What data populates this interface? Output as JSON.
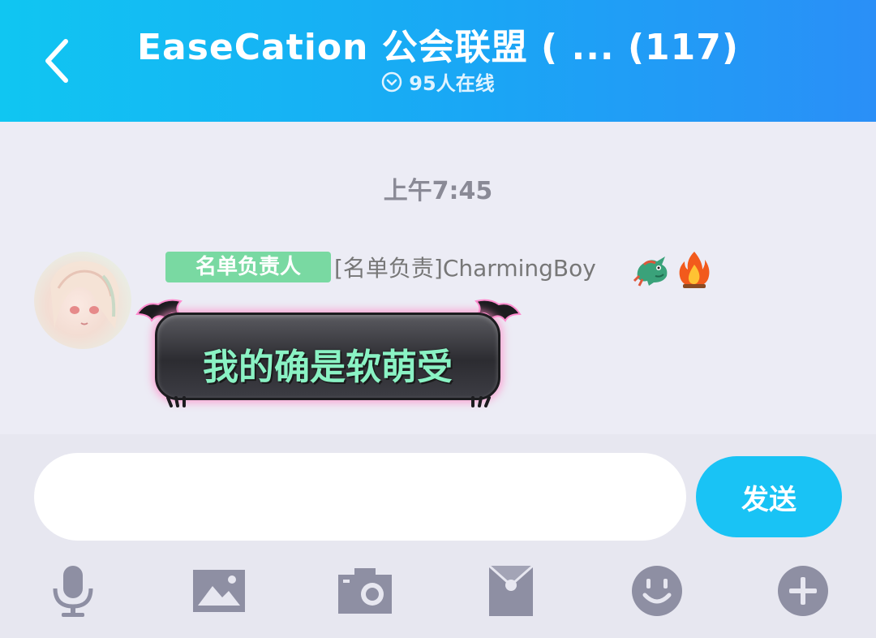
{
  "header": {
    "title": "EaseCation 公会联盟 ( ... (117)",
    "online_text": "95人在线",
    "back_icon": "chevron-left-icon"
  },
  "chat": {
    "timestamp": "上午7:45",
    "messages": [
      {
        "badge": "名单负责人",
        "sender": "[名单负责]CharmingBoy",
        "sender_emojis": [
          "dragon-emoji",
          "fire-emoji"
        ],
        "text": "我的确是软萌受"
      }
    ]
  },
  "composer": {
    "input_value": "",
    "input_placeholder": "",
    "send_label": "发送"
  },
  "toolbar": {
    "icons": [
      "microphone-icon",
      "image-icon",
      "camera-icon",
      "red-packet-icon",
      "emoji-icon",
      "plus-icon"
    ]
  },
  "colors": {
    "header_start": "#10c6f2",
    "header_end": "#2a8ff7",
    "send_button": "#19c3f5",
    "badge": "#79d9a2",
    "bubble_text": "#8af2c4",
    "toolbar_icon": "#8e8fa3"
  }
}
